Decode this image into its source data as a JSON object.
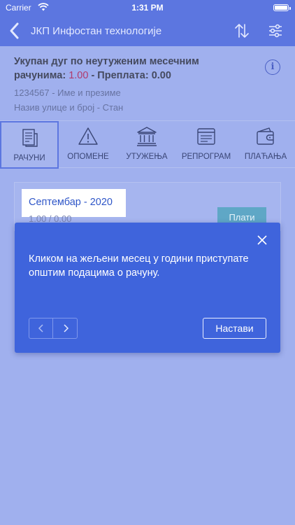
{
  "status_bar": {
    "carrier": "Carrier",
    "time": "1:31 PM"
  },
  "nav": {
    "title": "ЈКП Инфостан технологије",
    "icons": [
      "back-icon",
      "sort-icon",
      "filter-icon"
    ]
  },
  "header": {
    "debt_label": "Укупан дуг по неутуженим месечним рачунима:",
    "debt_amount": "1.00",
    "overpay_label": "- Преплата:",
    "overpay_amount": "0.00",
    "account": "1234567 - Име и презиме",
    "address": "Назив улице и број - Стан",
    "info_icon": "i"
  },
  "tabs": [
    {
      "label": "РАЧУНИ",
      "icon": "bills-icon",
      "active": true
    },
    {
      "label": "ОПОМЕНЕ",
      "icon": "warning-icon",
      "active": false
    },
    {
      "label": "УТУЖЕЊА",
      "icon": "court-icon",
      "active": false
    },
    {
      "label": "РЕПРОГРАМ",
      "icon": "reprogram-icon",
      "active": false
    },
    {
      "label": "ПЛАЋАЊА",
      "icon": "wallet-icon",
      "active": false
    }
  ],
  "bill": {
    "month": "Септембар - 2020",
    "amounts": "1.00 / 0.00",
    "pay_label": "Плати"
  },
  "tooltip": {
    "message": "Кликом на жељени месец у години приступате општим подацима о рачуну.",
    "continue_label": "Настави"
  },
  "colors": {
    "nav": "#5c76e0",
    "overlay": "#a0b0ee",
    "tooltip": "#3f64dc",
    "debt_amount": "#b03a6c",
    "pay_button": "#5fa7c6"
  }
}
